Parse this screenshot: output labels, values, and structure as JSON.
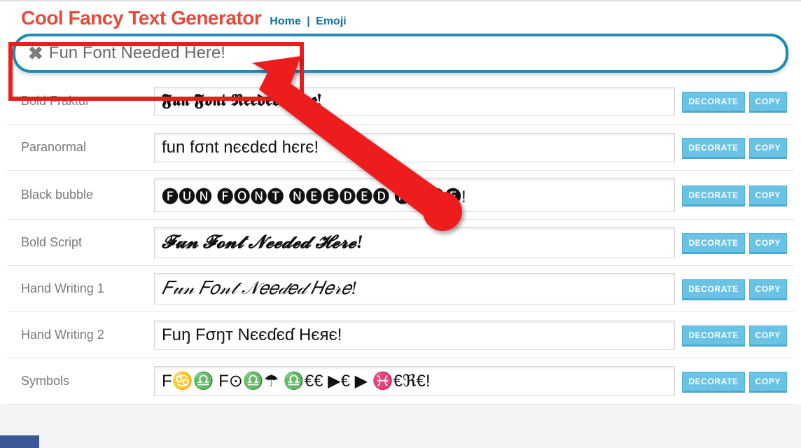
{
  "brand": "Cool Fancy Text Generator",
  "nav": {
    "home": "Home",
    "emoji": "Emoji"
  },
  "input": {
    "value": "Fun Font Needed Here!",
    "clear_glyph": "✖"
  },
  "buttons": {
    "decorate": "DECORATE",
    "copy": "COPY"
  },
  "rows": [
    {
      "label": "Bold Fraktur",
      "sample": "𝕱𝖚𝖓 𝕱𝖔𝖓𝖙 𝕹𝖊𝖊𝖉𝖊𝖉 𝕳𝖊𝖗𝖊!",
      "class": "style-fraktur"
    },
    {
      "label": "Paranormal",
      "sample": "fun fσnt nєєdєd hєrє!",
      "class": ""
    },
    {
      "label": "Black bubble",
      "sample": "🅕🅤🅝 🅕🅞🅝🅣 🅝🅔🅔🅓🅔🅓 🅗🅔🅡🅔!",
      "class": ""
    },
    {
      "label": "Bold Script",
      "sample": "𝓕𝓾𝓷 𝓕𝓸𝓷𝓽 𝓝𝓮𝓮𝓭𝓮𝓭 𝓗𝓮𝓻𝓮!",
      "class": "style-script"
    },
    {
      "label": "Hand Writing 1",
      "sample": "𝐹𝓊𝓃 𝐹𝑜𝓃𝓉 𝒩𝑒𝑒𝒹𝑒𝒹 𝐻𝑒𝓇𝑒!",
      "class": "style-hand1"
    },
    {
      "label": "Hand Writing 2",
      "sample": "Fuŋ Fσŋт Nєєɗєɗ Hєяє!",
      "class": ""
    },
    {
      "label": "Symbols",
      "sample": "F♋♎ F⊙♎☂ ♎€€ ▶€ ▶ ♓€ℜ€!",
      "class": ""
    }
  ]
}
